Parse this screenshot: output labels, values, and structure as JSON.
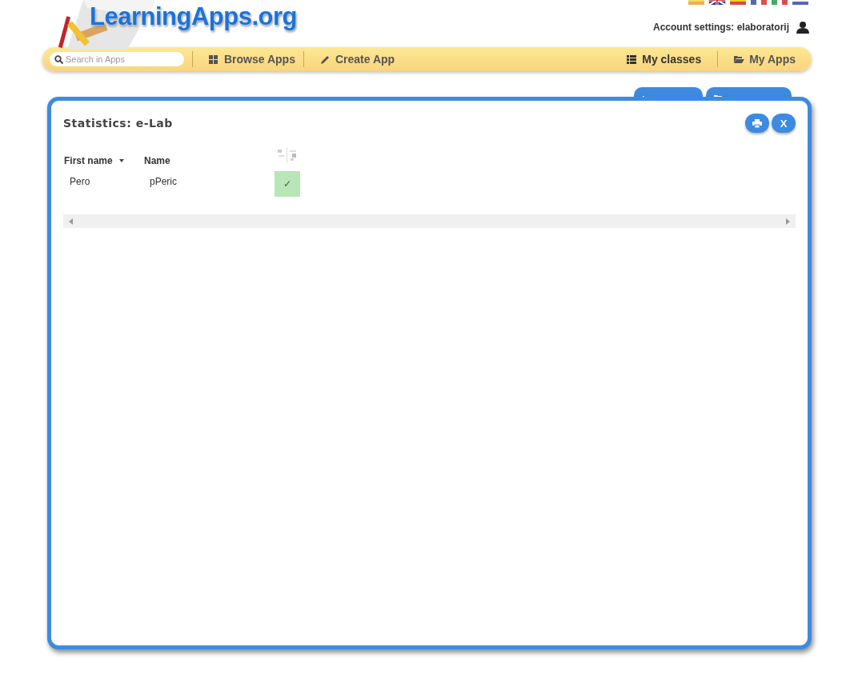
{
  "header": {
    "logo": "LearningApps.org",
    "languages": [
      {
        "selected": false
      },
      {
        "selected": true
      },
      {
        "selected": false
      },
      {
        "selected": false
      },
      {
        "selected": false
      },
      {
        "selected": false
      }
    ],
    "account": "Account settings: elaboratorij"
  },
  "nav": {
    "search": {
      "placeholder": "Search in Apps"
    },
    "items": [
      {
        "label": "Browse Apps",
        "selected": false
      },
      {
        "label": "Create App",
        "selected": false
      },
      {
        "label": "My classes",
        "selected": true
      },
      {
        "label": "My Apps",
        "selected": false
      }
    ]
  },
  "page_buttons": [
    {
      "kind": "statistics"
    },
    {
      "kind": "folder"
    }
  ],
  "dialog": {
    "title": "Statistics: e-Lab",
    "buttons": [
      {
        "kind": "print"
      },
      {
        "kind": "close",
        "label": "X"
      }
    ],
    "table": {
      "columns": [
        {
          "label": "First name",
          "sorted": true
        },
        {
          "label": "Name",
          "sorted": false
        },
        {
          "kind": "app"
        }
      ],
      "rows": [
        {
          "cells": [
            "Pero",
            "pPeric"
          ],
          "solved": true,
          "mark": "✓"
        }
      ]
    }
  }
}
